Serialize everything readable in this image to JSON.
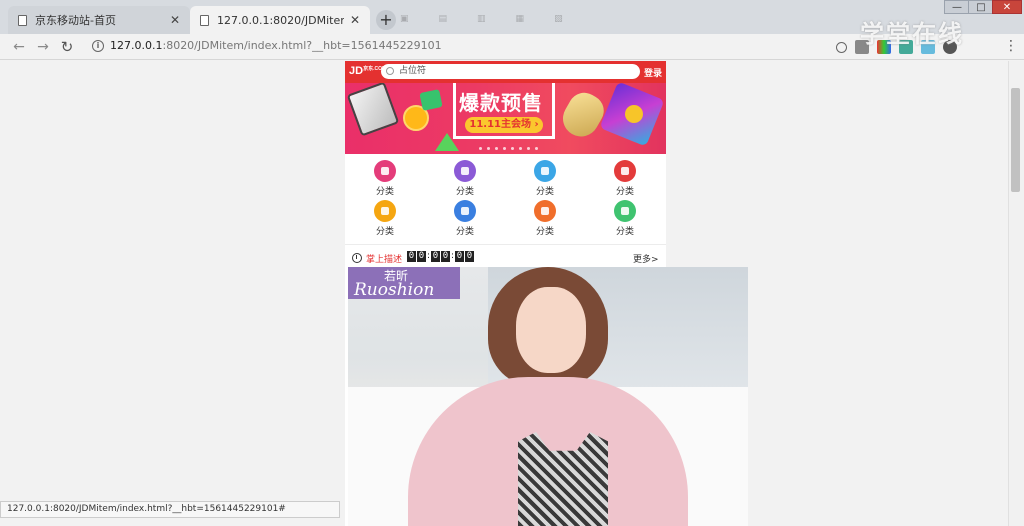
{
  "browser": {
    "tabs": [
      {
        "title": "京东移动站-首页",
        "active": false
      },
      {
        "title": "127.0.0.1:8020/JDMitem/inde",
        "active": true
      }
    ],
    "new_tab_label": "+",
    "window_controls": {
      "minimize": "—",
      "maximize": "□",
      "close": "✕"
    },
    "url": {
      "host": "127.0.0.1",
      "rest": ":8020/JDMitem/index.html?__hbt=1561445229101"
    },
    "status_url": "127.0.0.1:8020/JDMitem/index.html?__hbt=1561445229101#",
    "watermark": "学堂在线",
    "menu": "⋮"
  },
  "jd": {
    "logo": "JD",
    "logo_small": "京东.COM",
    "search_placeholder": "占位符",
    "login": "登录",
    "banner": {
      "title": "爆款预售",
      "cta": "11.11主会场 ›",
      "dot_count": 8
    },
    "categories": [
      {
        "label": "分类",
        "icon": "grid-icon",
        "color": "#e43c7a"
      },
      {
        "label": "分类",
        "icon": "gift-icon",
        "color": "#8b5ad6"
      },
      {
        "label": "分类",
        "icon": "cart-icon",
        "color": "#3ba6e6"
      },
      {
        "label": "分类",
        "icon": "person-icon",
        "color": "#e33b3b"
      },
      {
        "label": "分类",
        "icon": "book-icon",
        "color": "#f5a611"
      },
      {
        "label": "分类",
        "icon": "card-icon",
        "color": "#3a7fe0"
      },
      {
        "label": "分类",
        "icon": "tag-icon",
        "color": "#f06e2b"
      },
      {
        "label": "分类",
        "icon": "heart-icon",
        "color": "#3fc370"
      }
    ],
    "seckill": {
      "title": "掌上描述",
      "timer": [
        "0",
        "0",
        ":",
        "0",
        "0",
        ":",
        "0",
        "0"
      ],
      "more": "更多>"
    },
    "promo": {
      "brand_cn": "若昕",
      "brand_en": "Ruoshion"
    }
  },
  "colors": {
    "jd_red": "#e43130",
    "banner_pink": "#ea2f69",
    "cta_yellow": "#fbc72e"
  }
}
